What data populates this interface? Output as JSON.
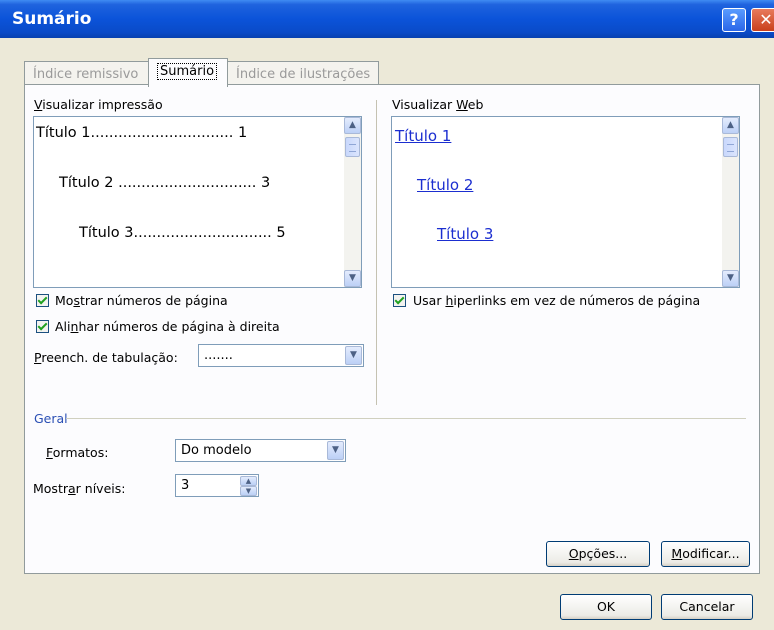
{
  "window": {
    "title": "Sumário",
    "help_glyph": "?",
    "close_glyph": "✕"
  },
  "tabs": [
    {
      "label": "Índice remissivo"
    },
    {
      "label": "Sumário"
    },
    {
      "label": "Índice de ilustrações"
    }
  ],
  "print_preview": {
    "label_u": "V",
    "label_rest": "isualizar impressão",
    "lines": [
      {
        "text": "Título 1",
        "dots": "...............................",
        "page": "1"
      },
      {
        "text": "Título 2",
        "dots": " ..............................",
        "page": "3"
      },
      {
        "text": "Título 3",
        "dots": "..............................",
        "page": "5"
      }
    ]
  },
  "web_preview": {
    "label_pre": "Visualizar ",
    "label_u": "W",
    "label_rest": "eb",
    "links": [
      "Título 1",
      "Título 2",
      "Título 3"
    ]
  },
  "options": {
    "show_page_numbers": {
      "pre": "Mo",
      "u": "s",
      "rest": "trar números de página",
      "checked": true
    },
    "align_right": {
      "pre": "Ali",
      "u": "n",
      "rest": "har números de página à direita",
      "checked": true
    },
    "use_hyperlinks": {
      "pre": "Usar ",
      "u": "h",
      "rest": "iperlinks em vez de números de página",
      "checked": true
    },
    "tab_leader": {
      "u": "P",
      "rest": "reench. de tabulação:",
      "value": "......."
    }
  },
  "general": {
    "title": "Geral",
    "formats": {
      "u": "F",
      "rest": "ormatos:",
      "value": "Do modelo"
    },
    "levels": {
      "pre": "Mostr",
      "u": "a",
      "rest": "r níveis:",
      "value": "3"
    }
  },
  "buttons": {
    "options": {
      "u": "O",
      "rest": "pções..."
    },
    "modify": {
      "u": "M",
      "rest": "odificar..."
    },
    "ok": "OK",
    "cancel": "Cancelar"
  },
  "icons": {
    "scroll_up": "▲",
    "scroll_down": "▼",
    "dropdown": "▼",
    "spin_up": "▲",
    "spin_down": "▼"
  },
  "colors": {
    "titlebar": "#0b53d9",
    "link": "#1b2ed0",
    "check": "#21a121",
    "dialog_bg": "#ece9d8"
  }
}
